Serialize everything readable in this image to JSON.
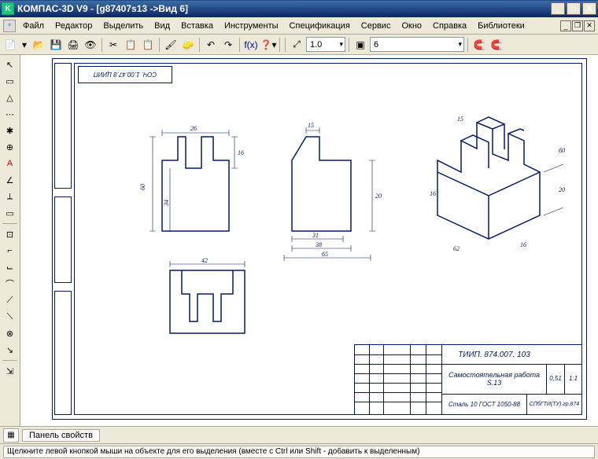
{
  "title": "КОМПАС-3D V9 - [g87407s13 ->Вид 6]",
  "menu": [
    "Файл",
    "Редактор",
    "Выделить",
    "Вид",
    "Вставка",
    "Инструменты",
    "Спецификация",
    "Сервис",
    "Окно",
    "Справка",
    "Библиотеки"
  ],
  "toolbar1": {
    "icons": [
      "📄",
      "▾",
      "📂",
      "💾",
      "🖨",
      "👁",
      "✂",
      "📋",
      "📋",
      "🖌",
      "🧽",
      "",
      "↶",
      "↷",
      "",
      "f(x)",
      "❓▾"
    ],
    "combo_scale": "1.0",
    "combo_state": "6",
    "magnet_on": "🧲",
    "magnet_off": "🧲"
  },
  "sidebar_icons": [
    "↖",
    "▭",
    "△",
    "⋯",
    "✱",
    "⊕",
    "A",
    "∠",
    "⟂",
    "▭",
    "",
    "⊡",
    "⌐",
    "⌙",
    "⌒",
    "⟋",
    "⟍",
    "⊗",
    "↘",
    "",
    "⇲"
  ],
  "panel": {
    "label": "Панель свойств"
  },
  "status_text": "Щелкните левой кнопкой мыши на объекте для его выделения (вместе с Ctrl или Shift - добавить к выделенным)",
  "drawing": {
    "stamp_top": "СОЧ. 1.00.47.8 ЦИИП",
    "dims": {
      "d26": "26",
      "d16": "16",
      "d60": "60",
      "d34": "34",
      "d15": "15",
      "d31": "31",
      "d38": "38",
      "d65": "65",
      "d20": "20",
      "d42": "42",
      "iso1": "15",
      "iso2": "20",
      "iso3": "16",
      "iso4": "62",
      "iso5": "16",
      "iso6": "60"
    },
    "titleblock": {
      "code": "ТИИП. 874.007. 103",
      "name": "Самостоятельная работа S.13",
      "material": "Сталь 10 ГОСТ 1050-88",
      "org": "СПбГТИ(ТУ) гр.874",
      "mass": "0,51",
      "scale": "1:1"
    }
  }
}
